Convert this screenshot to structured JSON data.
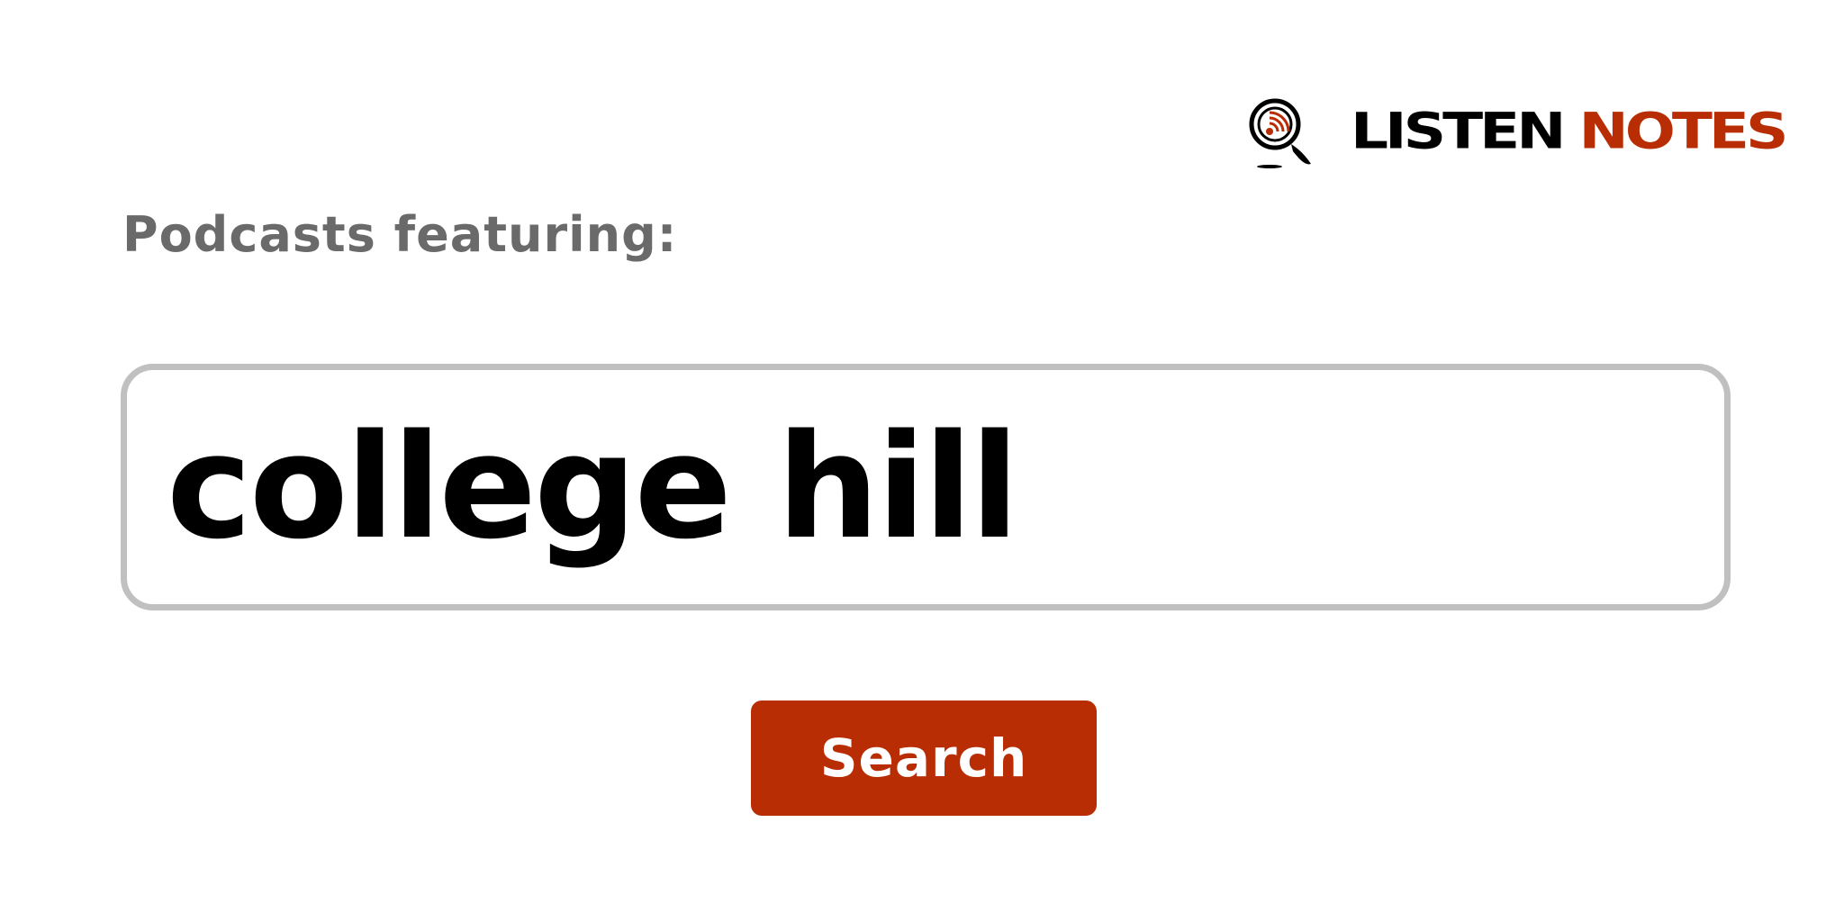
{
  "brand": {
    "icon": "magnifier-podcast-icon",
    "word1": "LISTEN",
    "word2": "NOTES",
    "colors": {
      "dark": "#000000",
      "accent": "#b92d04"
    }
  },
  "heading": "Podcasts featuring:",
  "search": {
    "query": "college hill",
    "button_label": "Search",
    "border_color": "#c0c0c0",
    "button_color": "#b92d04"
  }
}
